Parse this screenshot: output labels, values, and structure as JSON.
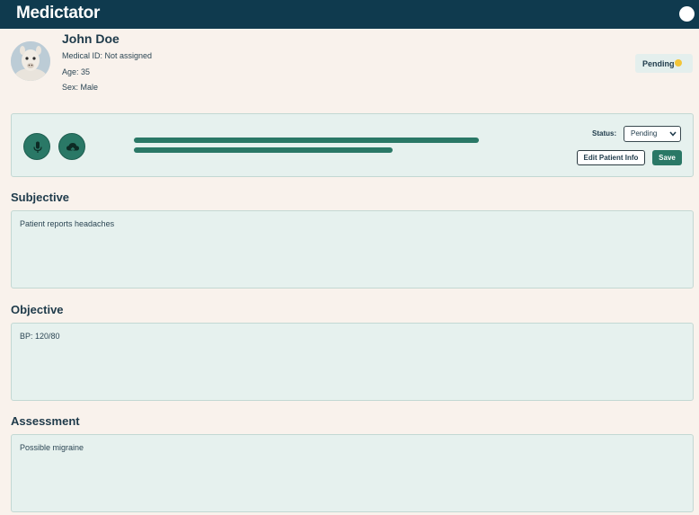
{
  "header": {
    "app_title": "Medictator",
    "user_icon": "avatar-circle-icon",
    "bar_color": "#0f3a4e"
  },
  "patient": {
    "name": "John Doe",
    "medical_id": "Medical ID: Not assigned",
    "age": "Age: 35",
    "sex": "Sex: Male",
    "avatar": "alpaca-photo"
  },
  "status_badge": {
    "label": "Pending",
    "dot_color": "#f3c538"
  },
  "controls": {
    "mic_icon": "microphone-icon",
    "upload_icon": "cloud-upload-icon",
    "waveform_levels": [
      1.0,
      0.75
    ],
    "status_label": "Status:",
    "status_value": "Pending",
    "edit_label": "Edit Patient Info",
    "save_label": "Save",
    "accent_color": "#2a7866"
  },
  "sections": [
    {
      "title": "Subjective",
      "content": "Patient reports headaches"
    },
    {
      "title": "Objective",
      "content": "BP: 120/80"
    },
    {
      "title": "Assessment",
      "content": "Possible migraine"
    }
  ]
}
